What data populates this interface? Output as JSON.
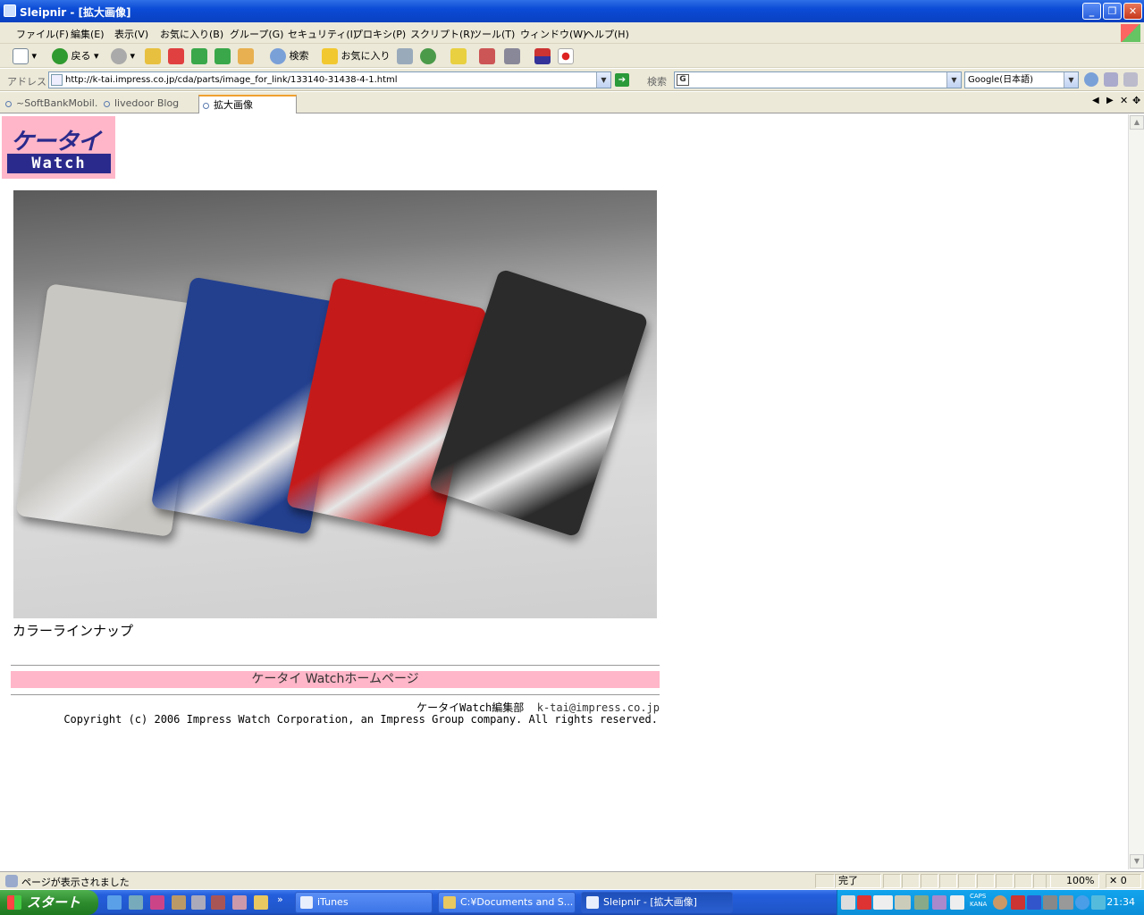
{
  "window": {
    "title": "Sleipnir - [拡大画像]"
  },
  "menu": [
    "ファイル(F)",
    "編集(E)",
    "表示(V)",
    "お気に入り(B)",
    "グループ(G)",
    "セキュリティ(I)",
    "プロキシ(P)",
    "スクリプト(R)",
    "ツール(T)",
    "ウィンドウ(W)",
    "ヘルプ(H)"
  ],
  "toolbar": {
    "back_label": "戻る",
    "search_label": "検索",
    "favorites_label": "お気に入り"
  },
  "address": {
    "label": "アドレス",
    "url": "http://k-tai.impress.co.jp/cda/parts/image_for_link/133140-31438-4-1.html"
  },
  "search": {
    "label": "検索",
    "engine": "Google(日本語)"
  },
  "tabs": [
    {
      "label": "~SoftBankMobil...",
      "active": false
    },
    {
      "label": "livedoor Blog",
      "active": false
    },
    {
      "label": "拡大画像",
      "active": true
    }
  ],
  "page": {
    "logo_top": "ケータイ",
    "logo_bottom": "Watch",
    "caption": "カラーラインナップ",
    "home_link": "ケータイ Watchホームページ",
    "editorial_label": "ケータイWatch編集部",
    "editorial_email": "k-tai@impress.co.jp",
    "copyright": "Copyright (c) 2006 Impress Watch Corporation, an Impress Group company. All rights reserved.",
    "phone_colors": [
      "#c9c7c2",
      "#23408f",
      "#c51a1a",
      "#2b2b2b"
    ]
  },
  "status": {
    "message": "ページが表示されました",
    "state": "完了",
    "zoom": "100%",
    "count": "0"
  },
  "taskbar": {
    "start_label": "スタート",
    "tasks": [
      {
        "label": "iTunes",
        "active": false
      },
      {
        "label": "C:¥Documents and S...",
        "active": false
      },
      {
        "label": "Sleipnir - [拡大画像]",
        "active": true
      }
    ],
    "clock": "21:34",
    "caps": "CAPS",
    "kana": "KANA"
  }
}
